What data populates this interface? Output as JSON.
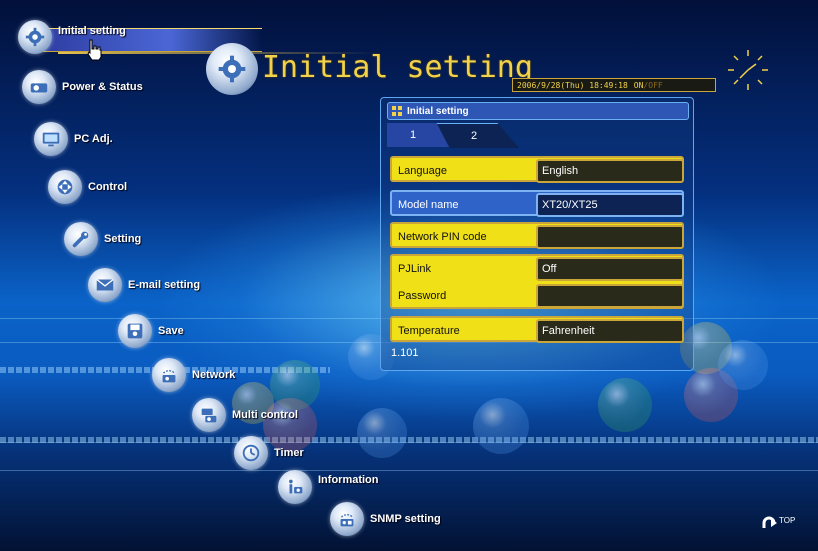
{
  "header": {
    "title": "Initial setting",
    "clock": "2006/9/28(Thu) 18:49:18",
    "clock_on": "ON",
    "clock_sep": "/",
    "clock_off": "OFF",
    "icon": "gear-icon"
  },
  "menu": {
    "items": [
      {
        "label": "Initial setting",
        "icon": "gear-icon",
        "active": true
      },
      {
        "label": "Power & Status",
        "icon": "projector-icon"
      },
      {
        "label": "PC Adj.",
        "icon": "monitor-icon"
      },
      {
        "label": "Control",
        "icon": "arrows-icon"
      },
      {
        "label": "Setting",
        "icon": "wrench-icon"
      },
      {
        "label": "E-mail setting",
        "icon": "envelope-icon"
      },
      {
        "label": "Save",
        "icon": "save-icon"
      },
      {
        "label": "Network",
        "icon": "network-icon"
      },
      {
        "label": "Multi control",
        "icon": "multi-projector-icon"
      },
      {
        "label": "Timer",
        "icon": "clock-icon"
      },
      {
        "label": "Information",
        "icon": "info-icon"
      },
      {
        "label": "SNMP setting",
        "icon": "snmp-icon"
      }
    ]
  },
  "panel": {
    "title": "Initial setting",
    "tabs": [
      {
        "label": "1",
        "active": true
      },
      {
        "label": "2",
        "active": false
      }
    ],
    "rows": {
      "language": {
        "label": "Language",
        "value": "English"
      },
      "model_name": {
        "label": "Model name",
        "value": "XT20/XT25"
      },
      "network_pin": {
        "label": "Network PIN code",
        "value": ""
      },
      "pjlink": {
        "label": "PJLink",
        "value": "Off"
      },
      "password": {
        "label": "Password",
        "value": ""
      },
      "temperature": {
        "label": "Temperature",
        "value": "Fahrenheit"
      }
    },
    "version": "1.101"
  },
  "footer": {
    "top_label": "TOP",
    "top_icon": "return-arrow-icon"
  },
  "colors": {
    "accent_yellow": "#efe018",
    "title_gold": "#f2d24a",
    "panel_blue": "#2e56b4"
  }
}
